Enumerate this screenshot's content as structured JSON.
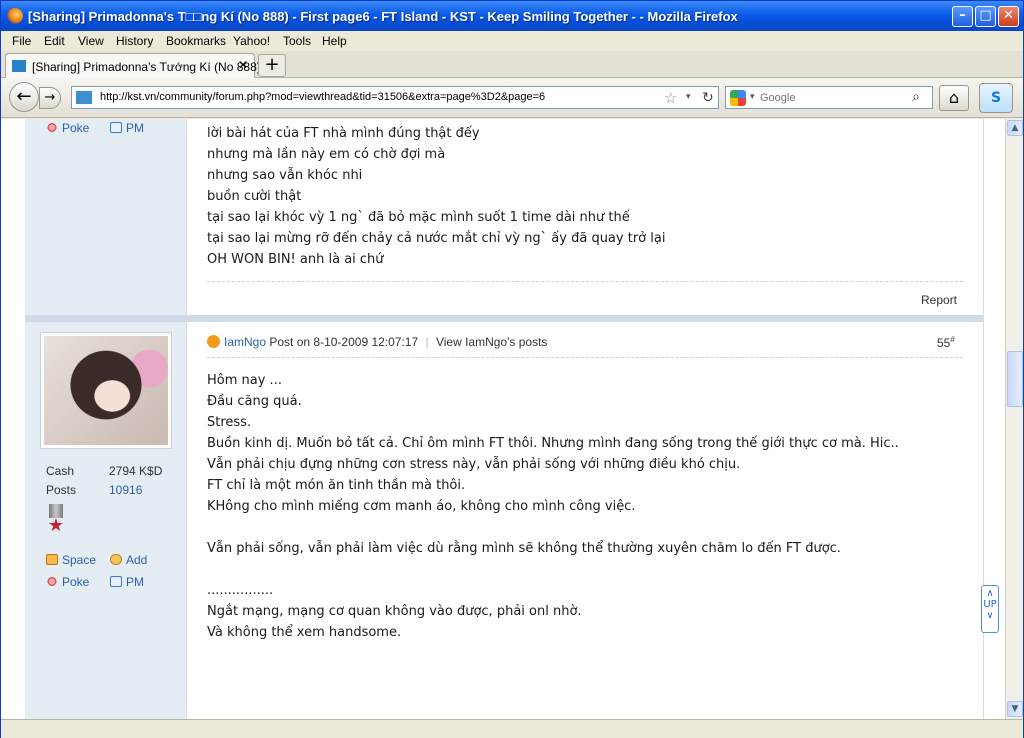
{
  "window": {
    "title": "[Sharing] Primadonna's T□□ng Kí (No 888) - First page6 - FT Island - KST - Keep Smiling Together - - Mozilla Firefox",
    "min": "–",
    "max": "□",
    "close": "✕"
  },
  "menu": [
    "File",
    "Edit",
    "View",
    "History",
    "Bookmarks",
    "Yahoo!",
    "Tools",
    "Help"
  ],
  "tabs": [
    {
      "label": "[Sharing] Primadonna's Tướng Kí (No 888) - ...",
      "close": "✕"
    }
  ],
  "newtab": "+",
  "nav": {
    "back": "←",
    "forward": "→",
    "url": "http://kst.vn/community/forum.php?mod=viewthread&tid=31506&extra=page%3D2&page=6",
    "star": "☆",
    "dropdown": "▾",
    "reload": "↻",
    "search_placeholder": "Google",
    "search_dd": "▾",
    "magnifier": "⌕",
    "home": "⌂",
    "skype": "S"
  },
  "post1": {
    "poke": "Poke",
    "pm": "PM",
    "lines": [
      "lời bài hát của FT nhà mình đúng thật đếy",
      "nhưng mà lần này em có chờ đợi mà",
      "nhưng sao vẫn khóc nhi",
      "buồn cười thật",
      "tại sao lại khóc vỳ 1 ng` đã bỏ mặc mình suốt 1 time dài như thế",
      "tại sao lại mừng rỡ đến chảy cả nước mắt chỉ vỳ ng` ấy đã quay trở lại",
      "OH WON BIN! anh là ai chứ"
    ],
    "report": "Report"
  },
  "post2": {
    "author": "IamNgo",
    "meta": "Post on 8-10-2009 12:07:17",
    "sep": "|",
    "view_posts": "View IamNgo's posts",
    "number": "55",
    "number_sup": "#",
    "cash_label": "Cash",
    "cash_value": "2794 K$D",
    "posts_label": "Posts",
    "posts_value": "10916",
    "space": "Space",
    "add": "Add",
    "poke": "Poke",
    "pm": "PM",
    "lines": [
      "Hôm nay ...",
      "Đầu căng quá.",
      "Stress.",
      "Buồn kinh dị. Muốn bỏ tất cả. Chỉ ôm mình FT thôi. Nhưng mình đang sống trong thế giới thực cơ mà. Hic..",
      "Vẫn phải chịu đựng những cơn stress này, vẫn phải sống với những điều khó chịu.",
      "FT chỉ là một món ăn tinh thần mà thôi.",
      "KHông cho mình miếng cơm manh áo, không cho mình công việc.",
      "",
      "Vẫn phải sống, vẫn phải làm việc dù rằng mình sẽ không thể thường xuyên chăm lo đến FT được.",
      "",
      "................",
      "Ngắt mạng, mạng cơ quan không vào được, phải onl nhờ.",
      "Và không thể xem handsome."
    ]
  },
  "scrollbar": {
    "up": "▲",
    "down": "▼"
  },
  "updown": {
    "up": "∧",
    "label": "UP",
    "down": "∨"
  }
}
